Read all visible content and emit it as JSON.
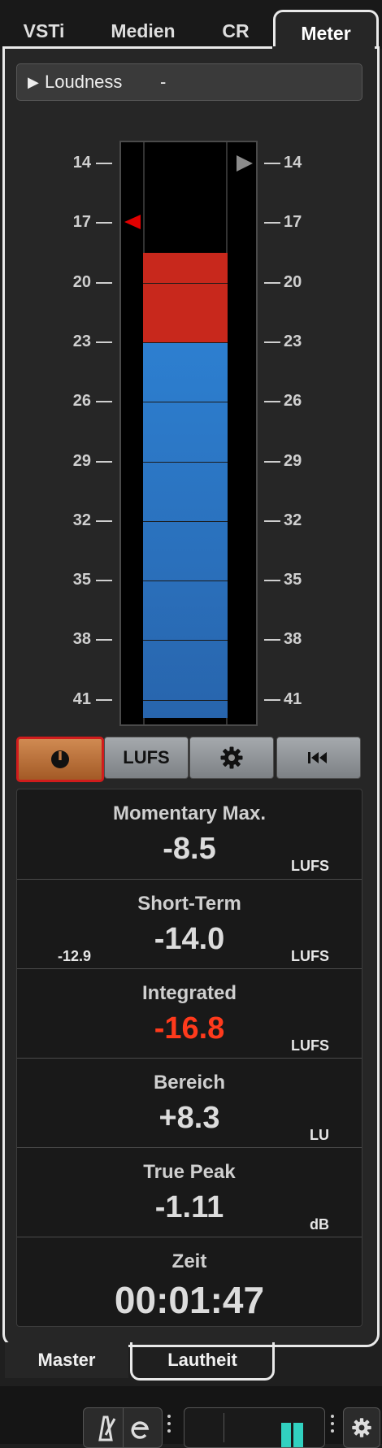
{
  "tabs": [
    "VSTi",
    "Medien",
    "CR",
    "Meter"
  ],
  "loudness_header": {
    "title": "Loudness",
    "value": "-"
  },
  "scale": {
    "ticks": [
      "14",
      "17",
      "20",
      "23",
      "26",
      "29",
      "32",
      "35",
      "38",
      "41"
    ],
    "fill_top_lufs": 18.5,
    "warning_threshold_lufs": 23,
    "target_marker_lufs": 17
  },
  "buttons": {
    "lufs": "LUFS"
  },
  "stats": [
    {
      "label": "Momentary Max.",
      "value": "-8.5",
      "unit": "LUFS"
    },
    {
      "label": "Short-Term",
      "value": "-14.0",
      "unit": "LUFS",
      "sub": "-12.9"
    },
    {
      "label": "Integrated",
      "value": "-16.8",
      "unit": "LUFS"
    },
    {
      "label": "Bereich",
      "value": "+8.3",
      "unit": "LU"
    },
    {
      "label": "True Peak",
      "value": "-1.11",
      "unit": "dB"
    },
    {
      "label": "Zeit",
      "value": "00:01:47"
    }
  ],
  "bottom_tabs": [
    "Master",
    "Lautheit"
  ],
  "colors": {
    "meter_blue": "#2d7fd0",
    "meter_red": "#c8281c",
    "integrated_value": "#ff3a1c",
    "power_button": "#c07a44"
  }
}
